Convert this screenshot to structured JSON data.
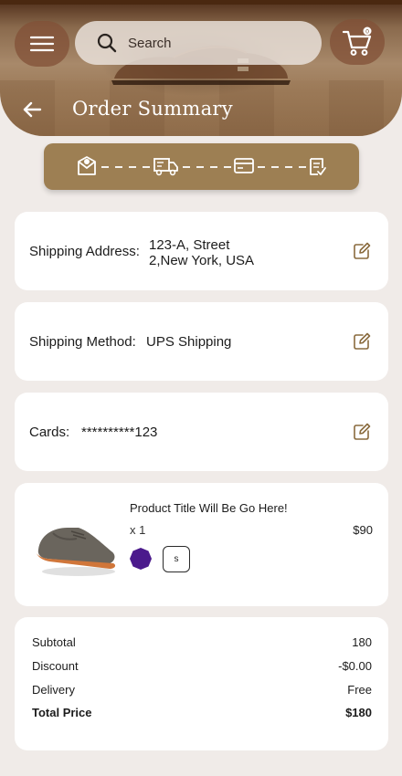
{
  "header": {
    "search_placeholder": "Search",
    "page_title": "Order Summary",
    "cart_count": "0"
  },
  "stepper": {
    "steps": [
      "order-placed-icon",
      "shipping-truck-icon",
      "payment-card-icon",
      "review-checklist-icon"
    ],
    "accent_color": "#9d7f53"
  },
  "shipping_address": {
    "label": "Shipping Address:",
    "line1": "123-A, Street",
    "line2": "2,New York, USA"
  },
  "shipping_method": {
    "label": "Shipping Method:",
    "value": "UPS Shipping"
  },
  "cards": {
    "label": "Cards:",
    "value": "**********123"
  },
  "product": {
    "title": "Product Title Will Be Go Here!",
    "quantity": "x 1",
    "price": "$90",
    "color": "#4b1a8c",
    "size": "s"
  },
  "summary": {
    "subtotal_label": "Subtotal",
    "subtotal_value": "180",
    "discount_label": "Discount",
    "discount_value": "-$0.00",
    "delivery_label": "Delivery",
    "delivery_value": "Free",
    "total_label": "Total Price",
    "total_value": "$180"
  }
}
